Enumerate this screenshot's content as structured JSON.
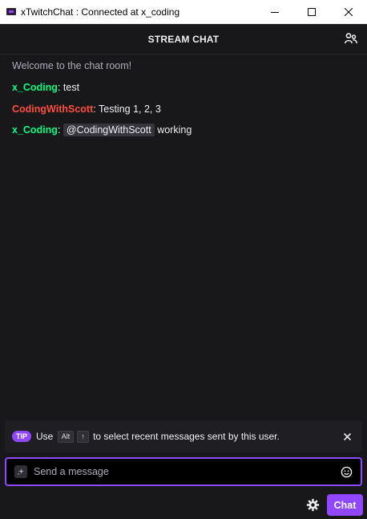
{
  "window": {
    "title": "xTwitchChat : Connected at x_coding"
  },
  "header": {
    "title": "STREAM CHAT",
    "users_icon": "users-icon"
  },
  "colors": {
    "accent": "#9147ff",
    "background": "#18181b",
    "user_x_coding": "#00ff7f",
    "user_codingwithscott": "#ff4f3c"
  },
  "messages": {
    "welcome": "Welcome to the chat room!",
    "m1": {
      "user": "x_Coding",
      "sep": ":",
      "text": "test"
    },
    "m2": {
      "user": "CodingWithScott",
      "sep": ":",
      "text": "Testing 1, 2, 3"
    },
    "m3": {
      "user": "x_Coding",
      "sep": ":",
      "mention": "@CodingWithScott",
      "text": "working"
    }
  },
  "tip": {
    "badge": "TIP",
    "use": "Use",
    "key1": "Alt",
    "key2": "↑",
    "rest": "to select recent messages sent by this user."
  },
  "input": {
    "placeholder": "Send a message",
    "value": ""
  },
  "footer": {
    "chat_button": "Chat"
  }
}
